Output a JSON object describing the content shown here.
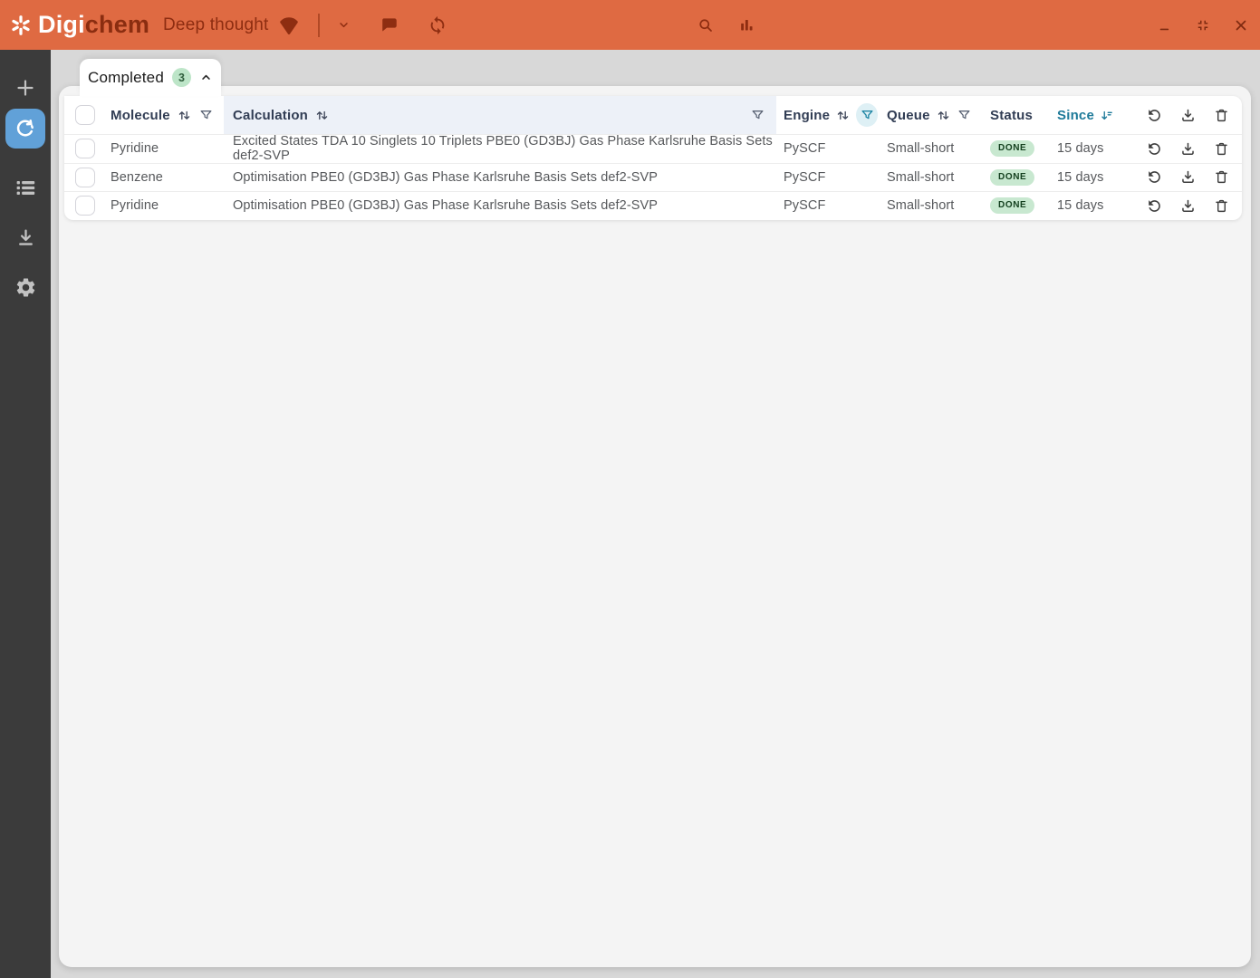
{
  "app": {
    "brand_part1": "Digi",
    "brand_part2": "chem",
    "project_name": "Deep thought"
  },
  "colors": {
    "topbar_bg": "#DF6A42",
    "topbar_accent": "#8E2D11",
    "sidebar_bg": "#3B3B3B",
    "sidebar_active_bg": "#61A1D8",
    "accent_teal": "#1E7A99",
    "header_text": "#313D54",
    "calculation_header_bg": "#EDF1F8",
    "status_done_bg": "#C8E8D0",
    "status_done_text": "#14401F",
    "tab_count_bg": "#BDE5C8"
  },
  "tab": {
    "label": "Completed",
    "count": "3"
  },
  "table": {
    "headers": {
      "molecule": "Molecule",
      "calculation": "Calculation",
      "engine": "Engine",
      "queue": "Queue",
      "status": "Status",
      "since": "Since"
    },
    "rows": [
      {
        "molecule": "Pyridine",
        "calculation": "Excited States TDA 10 Singlets 10 Triplets PBE0 (GD3BJ) Gas Phase Karlsruhe Basis Sets def2-SVP",
        "engine": "PySCF",
        "queue": "Small-short",
        "status": "DONE",
        "since": "15 days"
      },
      {
        "molecule": "Benzene",
        "calculation": "Optimisation PBE0 (GD3BJ) Gas Phase Karlsruhe Basis Sets def2-SVP",
        "engine": "PySCF",
        "queue": "Small-short",
        "status": "DONE",
        "since": "15 days"
      },
      {
        "molecule": "Pyridine",
        "calculation": "Optimisation PBE0 (GD3BJ) Gas Phase Karlsruhe Basis Sets def2-SVP",
        "engine": "PySCF",
        "queue": "Small-short",
        "status": "DONE",
        "since": "15 days"
      }
    ]
  }
}
